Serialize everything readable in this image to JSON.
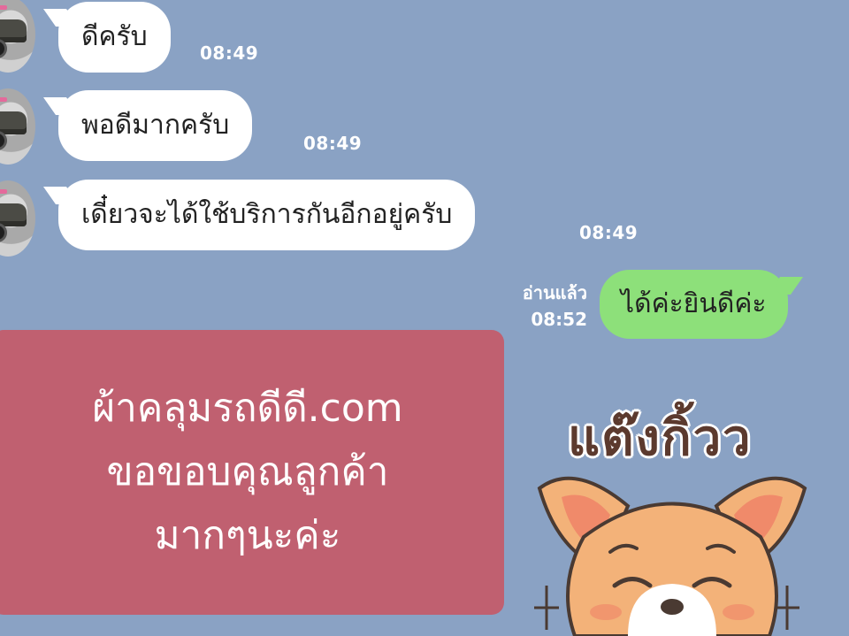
{
  "chat": {
    "incoming": [
      {
        "text": "ดีครับ",
        "time": "08:49"
      },
      {
        "text": "พอดีมากครับ",
        "time": "08:49"
      },
      {
        "text": "เดี๋ยวจะได้ใช้บริการกันอีกอยู่ครับ",
        "time": "08:49"
      }
    ],
    "outgoing": [
      {
        "text": "ได้ค่ะยินดีค่ะ",
        "read": "อ่านแล้ว",
        "time": "08:52"
      }
    ]
  },
  "promo": {
    "line1": "ผ้าคลุมรถดีดี.com",
    "line2": "ขอขอบคุณลูกค้า",
    "line3": "มากๆนะค่ะ"
  },
  "sticker": {
    "caption": "แต๊งกิ้วว",
    "icon": "smiling-dog-sticker"
  },
  "colors": {
    "background": "#8aa2c4",
    "incoming_bubble": "#ffffff",
    "outgoing_bubble": "#8de07a",
    "promo_card": "#c06070"
  }
}
